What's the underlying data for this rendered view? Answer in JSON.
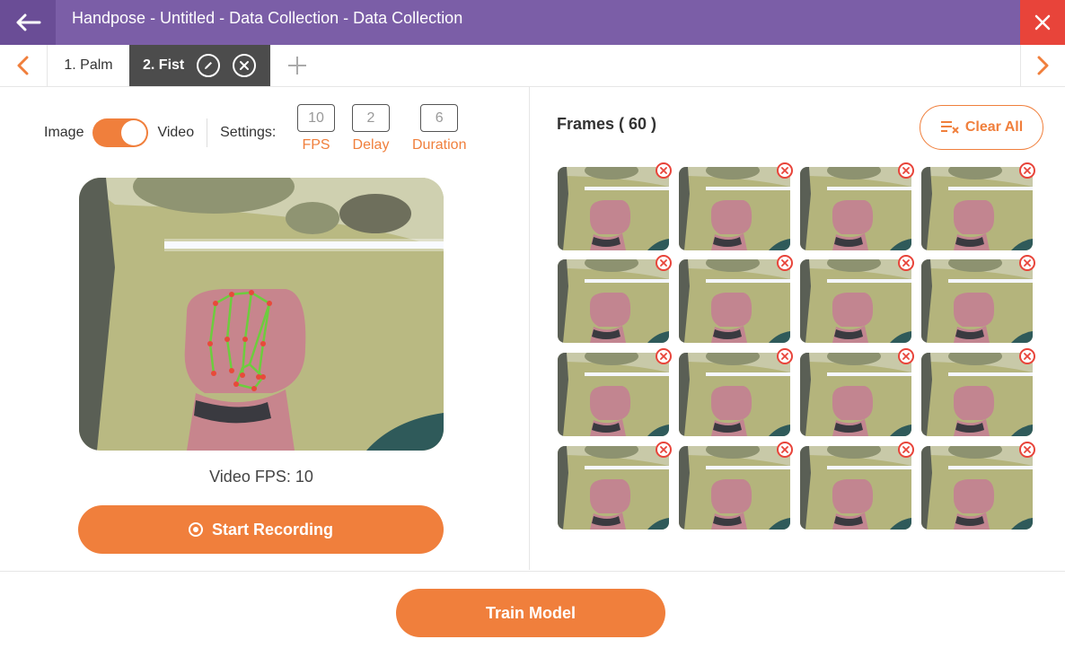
{
  "titlebar": {
    "title": "Handpose - Untitled - Data Collection - Data Collection"
  },
  "tabs": [
    {
      "label": "1. Palm",
      "active": false
    },
    {
      "label": "2. Fist",
      "active": true
    }
  ],
  "mode": {
    "image_label": "Image",
    "video_label": "Video",
    "selected": "Video"
  },
  "settings": {
    "label": "Settings:",
    "fps": {
      "value": "10",
      "label": "FPS"
    },
    "delay": {
      "value": "2",
      "label": "Delay"
    },
    "duration": {
      "value": "6",
      "label": "Duration"
    }
  },
  "camera": {
    "fps_text": "Video FPS: 10"
  },
  "record_button": "Start Recording",
  "frames": {
    "title": "Frames ( 60 )",
    "clear_label": "Clear All",
    "visible_count": 16
  },
  "train_button": "Train Model",
  "colors": {
    "titlebar": "#7b5ea7",
    "accent": "#f07f3c",
    "close": "#e8443a"
  }
}
